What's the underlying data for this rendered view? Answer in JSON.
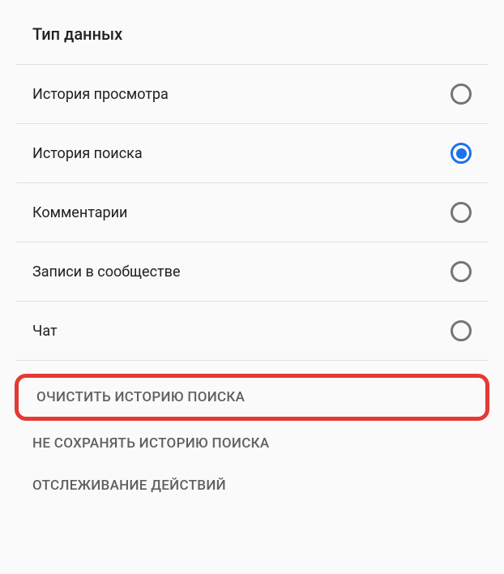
{
  "section_title": "Тип данных",
  "options": [
    {
      "label": "История просмотра",
      "selected": false
    },
    {
      "label": "История поиска",
      "selected": true
    },
    {
      "label": "Комментарии",
      "selected": false
    },
    {
      "label": "Записи в сообществе",
      "selected": false
    },
    {
      "label": "Чат",
      "selected": false
    }
  ],
  "actions": [
    {
      "label": "ОЧИСТИТЬ ИСТОРИЮ ПОИСКА",
      "highlighted": true
    },
    {
      "label": "НЕ СОХРАНЯТЬ ИСТОРИЮ ПОИСКА",
      "highlighted": false
    },
    {
      "label": "ОТСЛЕЖИВАНИЕ ДЕЙСТВИЙ",
      "highlighted": false
    }
  ],
  "colors": {
    "accent": "#1a73e8",
    "highlight_border": "#e53935"
  }
}
